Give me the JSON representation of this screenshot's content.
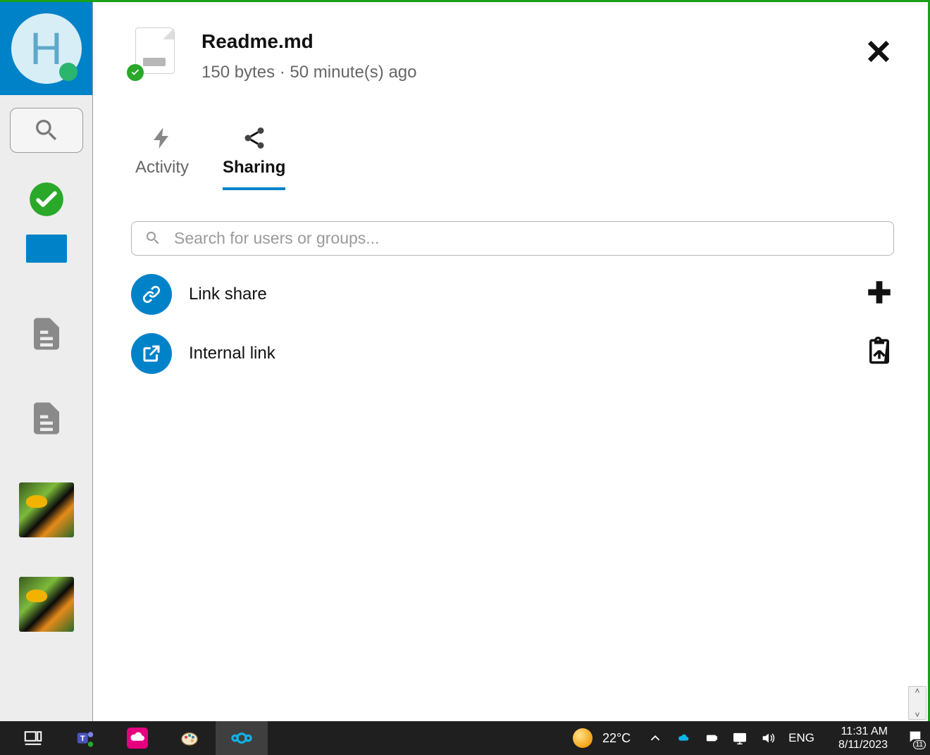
{
  "avatar": {
    "initial": "H"
  },
  "file": {
    "name": "Readme.md",
    "meta": "150 bytes · 50 minute(s) ago"
  },
  "tabs": {
    "activity": "Activity",
    "sharing": "Sharing"
  },
  "search": {
    "placeholder": "Search for users or groups..."
  },
  "share": {
    "link": "Link share",
    "internal": "Internal link"
  },
  "taskbar": {
    "temp": "22°C",
    "lang": "ENG",
    "time": "11:31 AM",
    "date": "8/11/2023",
    "notif_count": "11"
  }
}
